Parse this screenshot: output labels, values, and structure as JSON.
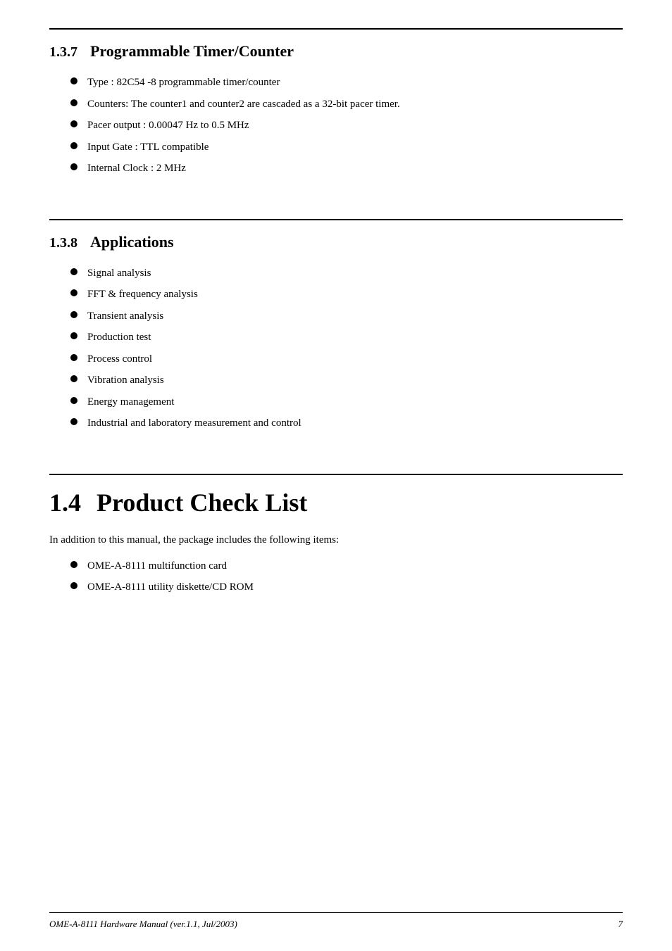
{
  "page": {
    "sections": [
      {
        "id": "section-137",
        "number": "1.3.7",
        "title": "Programmable Timer/Counter",
        "bullets": [
          "Type : 82C54 -8 programmable timer/counter",
          "Counters: The counter1 and counter2 are cascaded as a 32-bit pacer timer.",
          "Pacer output : 0.00047 Hz to 0.5 MHz",
          "Input Gate : TTL compatible",
          "Internal Clock : 2 MHz"
        ]
      },
      {
        "id": "section-138",
        "number": "1.3.8",
        "title": "Applications",
        "bullets": [
          "Signal analysis",
          "FFT & frequency analysis",
          "Transient analysis",
          "Production test",
          "Process control",
          "Vibration analysis",
          "Energy management",
          "Industrial and laboratory measurement and control"
        ]
      },
      {
        "id": "section-14",
        "number": "1.4",
        "title": "Product Check List",
        "intro": "In addition to this manual, the package includes the following items:",
        "bullets": [
          "OME-A-8111 multifunction card",
          "OME-A-8111 utility diskette/CD ROM"
        ]
      }
    ],
    "footer": {
      "left": "OME-A-8111 Hardware Manual (ver.1.1, Jul/2003)",
      "right": "7"
    }
  }
}
